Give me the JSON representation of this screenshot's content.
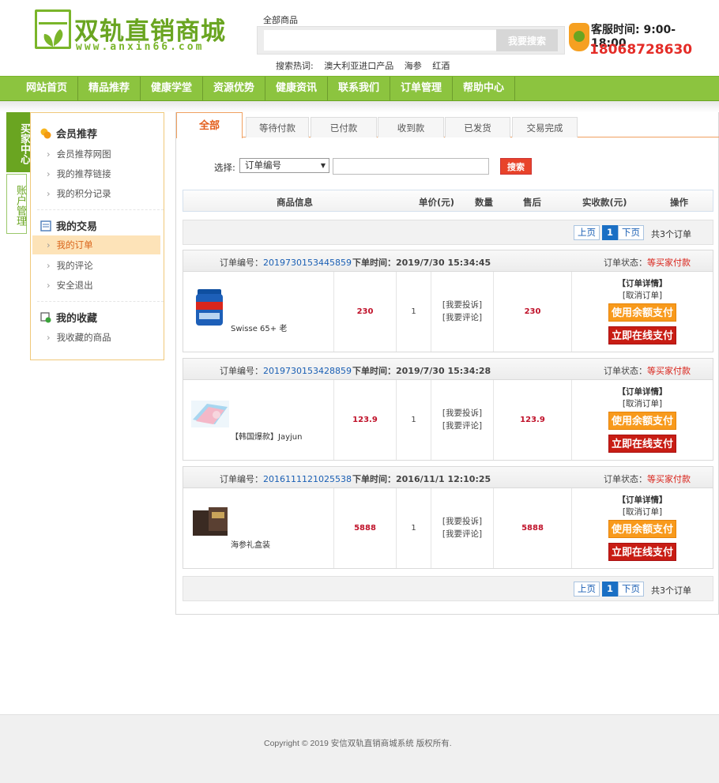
{
  "header": {
    "logo_title": "双轨直销商城",
    "logo_url": "www.anxin66.com",
    "search_category": "全部商品",
    "search_placeholder": "",
    "search_button": "我要搜索",
    "hot_label": "搜索热词:",
    "hot_words": [
      "澳大利亚进口产品",
      "海参",
      "红酒"
    ],
    "service_time": "客服时间: 9:00-18:00",
    "service_phone": "18068728630"
  },
  "nav": {
    "items": [
      "网站首页",
      "精品推荐",
      "健康学堂",
      "资源优势",
      "健康资讯",
      "联系我们",
      "订单管理",
      "帮助中心"
    ]
  },
  "side": {
    "buyer_center": "买家中心",
    "account_mgmt": "账户管理",
    "groups": [
      {
        "title": "会员推荐",
        "icon": "coins-icon",
        "items": [
          "会员推荐网图",
          "我的推荐链接",
          "我的积分记录"
        ]
      },
      {
        "title": "我的交易",
        "icon": "list-icon",
        "items": [
          "我的订单",
          "我的评论",
          "安全退出"
        ]
      },
      {
        "title": "我的收藏",
        "icon": "favorite-icon",
        "items": [
          "我收藏的商品"
        ]
      }
    ],
    "active_item": "我的订单"
  },
  "tabs": [
    "全部",
    "等待付款",
    "已付款",
    "收到款",
    "已发货",
    "交易完成"
  ],
  "filter": {
    "label": "选择:",
    "select_value": "订单编号",
    "input_value": "",
    "button": "搜索"
  },
  "table_header": {
    "product": "商品信息",
    "unit_price": "单价(元)",
    "qty": "数量",
    "after_sale": "售后",
    "paid": "实收款(元)",
    "ops": "操作"
  },
  "pager": {
    "prev": "上页",
    "current": "1",
    "next": "下页",
    "total": "共3个订单"
  },
  "labels": {
    "order_no": "订单编号：",
    "order_time": "下单时间：",
    "order_status": "订单状态：",
    "complain": "[我要投诉]",
    "comment": "[我要评论]",
    "detail": "【订单详情】",
    "cancel": "[取消订单]",
    "pay_balance": "使用余额支付",
    "pay_online": "立即在线支付"
  },
  "orders": [
    {
      "number": "2019730153445859",
      "time": "2019/7/30 15:34:45",
      "status": "等买家付款",
      "product": "Swisse 65+ 老",
      "price": "230",
      "qty": "1",
      "paid": "230"
    },
    {
      "number": "2019730153428859",
      "time": "2019/7/30 15:34:28",
      "status": "等买家付款",
      "product": "【韩国爆款】Jayjun",
      "price": "123.9",
      "qty": "1",
      "paid": "123.9"
    },
    {
      "number": "2016111121025538",
      "time": "2016/11/1 12:10:25",
      "status": "等买家付款",
      "product": "海参礼盒装",
      "price": "5888",
      "qty": "1",
      "paid": "5888"
    }
  ],
  "footer": {
    "copyright": "Copyright © 2019 安信双轨直销商城系统 版权所有."
  },
  "colors": {
    "brand_green": "#8cc43f",
    "accent_orange": "#e35d1a",
    "price_red": "#c0122a",
    "link_blue": "#1a5fb4"
  }
}
